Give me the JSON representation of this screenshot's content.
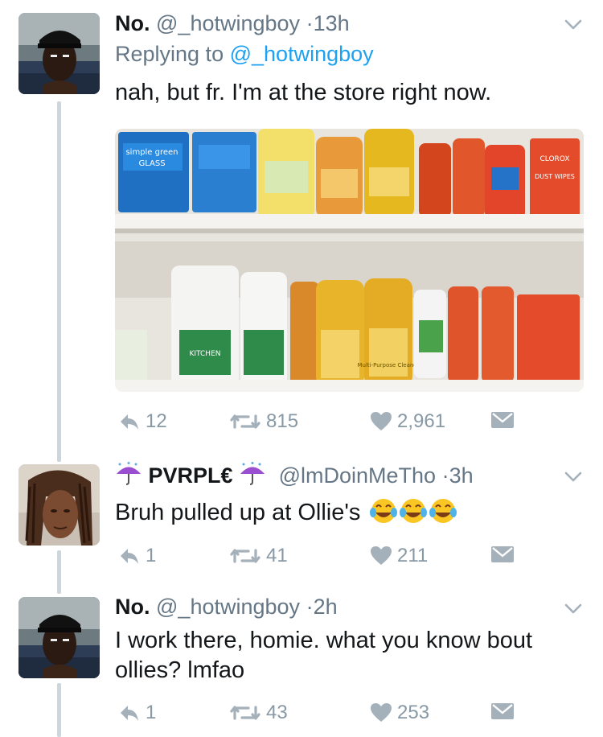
{
  "tweets": [
    {
      "name": "No.",
      "handle": "@_hotwingboy",
      "dot": "·",
      "time": "13h",
      "replying_prefix": "Replying to",
      "replying_handle": "@_hotwingboy",
      "text": "nah, but fr. I'm at the store right now.",
      "replies": "12",
      "retweets": "815",
      "likes": "2,961"
    },
    {
      "name": "PVRPL€",
      "handle": "@lmDoinMeTho",
      "dot": "·",
      "time": "3h",
      "text": "Bruh pulled up at Ollie's",
      "replies": "1",
      "retweets": "41",
      "likes": "211"
    },
    {
      "name": "No.",
      "handle": "@_hotwingboy",
      "dot": "·",
      "time": "2h",
      "text_line1": "I work there, homie. what you know bout",
      "text_line2": "ollies? lmfao",
      "replies": "1",
      "retweets": "43",
      "likes": "253"
    }
  ],
  "image": {
    "labels": {
      "simple_green": "simple green",
      "glass": "GLASS",
      "kitchen": "KITCHEN",
      "clorox": "CLOROX",
      "dust_wipes": "DUST WIPES",
      "multi_purpose": "Multi-Purpose Cleaner"
    }
  },
  "colors": {
    "accent": "#1da1f2",
    "muted": "#657786",
    "icon": "#8899a6",
    "thread": "#ccd6dd"
  }
}
